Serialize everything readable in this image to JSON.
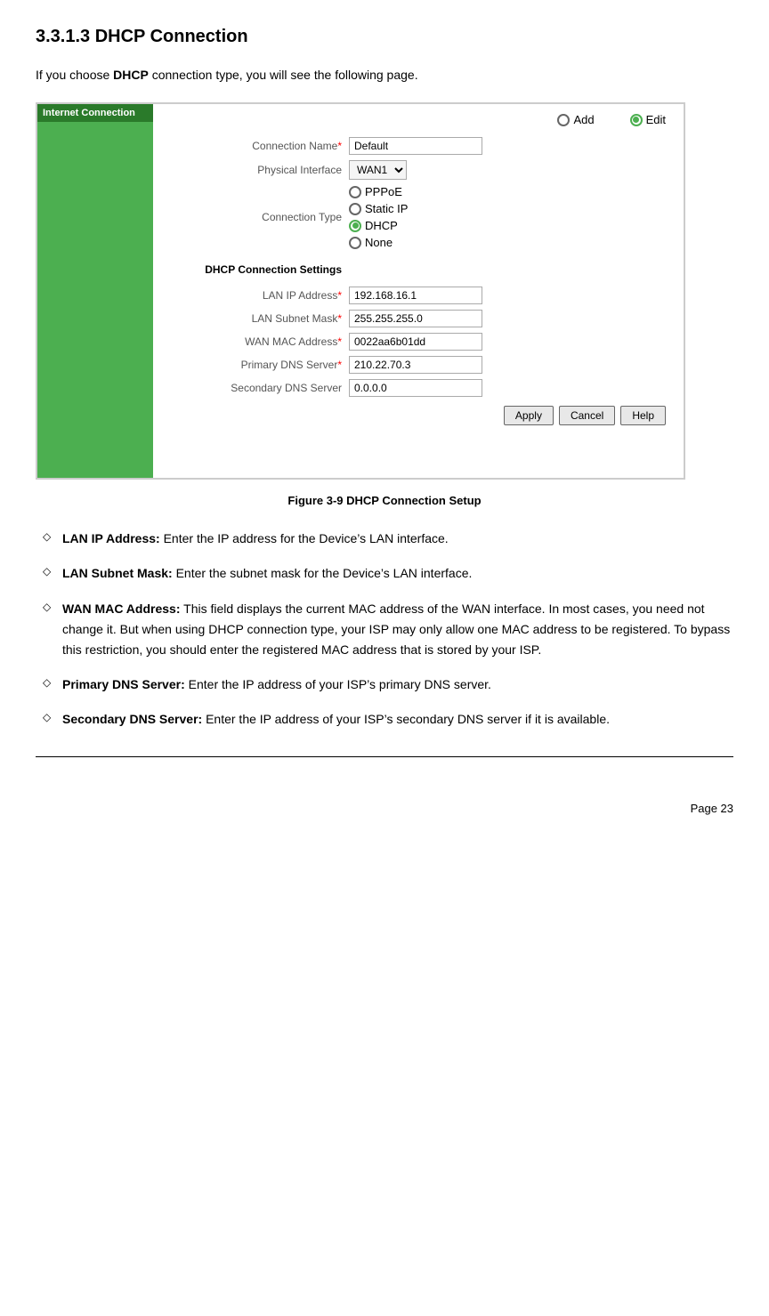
{
  "page": {
    "heading": "3.3.1.3  DHCP Connection",
    "intro_text": "If you choose ",
    "intro_bold": "DHCP",
    "intro_rest": " connection type, you will see the following page.",
    "figure_caption": "Figure 3-9 DHCP Connection Setup",
    "page_number": "Page  23"
  },
  "sidebar": {
    "label": "Internet Connection"
  },
  "top_buttons": {
    "add_label": "Add",
    "edit_label": "Edit"
  },
  "form": {
    "connection_name_label": "Connection Name",
    "connection_name_value": "Default",
    "physical_interface_label": "Physical Interface",
    "physical_interface_value": "WAN1",
    "connection_type_label": "Connection Type",
    "connection_types": [
      "PPPoE",
      "Static IP",
      "DHCP",
      "None"
    ],
    "selected_connection_type": "DHCP",
    "section_header": "DHCP Connection Settings",
    "lan_ip_label": "LAN IP Address",
    "lan_ip_value": "192.168.16.1",
    "lan_subnet_label": "LAN Subnet Mask",
    "lan_subnet_value": "255.255.255.0",
    "wan_mac_label": "WAN MAC Address",
    "wan_mac_value": "0022aa6b01dd",
    "primary_dns_label": "Primary DNS Server",
    "primary_dns_value": "210.22.70.3",
    "secondary_dns_label": "Secondary DNS Server",
    "secondary_dns_value": "0.0.0.0",
    "apply_btn": "Apply",
    "cancel_btn": "Cancel",
    "help_btn": "Help"
  },
  "bullets": [
    {
      "term": "LAN IP Address:",
      "text": " Enter the IP address for the Device’s LAN interface."
    },
    {
      "term": "LAN Subnet Mask:",
      "text": " Enter the subnet mask for the Device’s LAN interface."
    },
    {
      "term": "WAN MAC Address:",
      "text": " This field displays the current MAC address of the WAN interface. In most cases, you need not change it. But when using DHCP connection type, your ISP may only allow one MAC address to be registered. To bypass this restriction, you should enter the registered MAC address that is stored by your ISP."
    },
    {
      "term": "Primary DNS Server:",
      "text": " Enter the IP address of your ISP’s primary DNS server."
    },
    {
      "term": "Secondary DNS Server:",
      "text": " Enter the IP address of your ISP’s secondary DNS server if it is available."
    }
  ]
}
